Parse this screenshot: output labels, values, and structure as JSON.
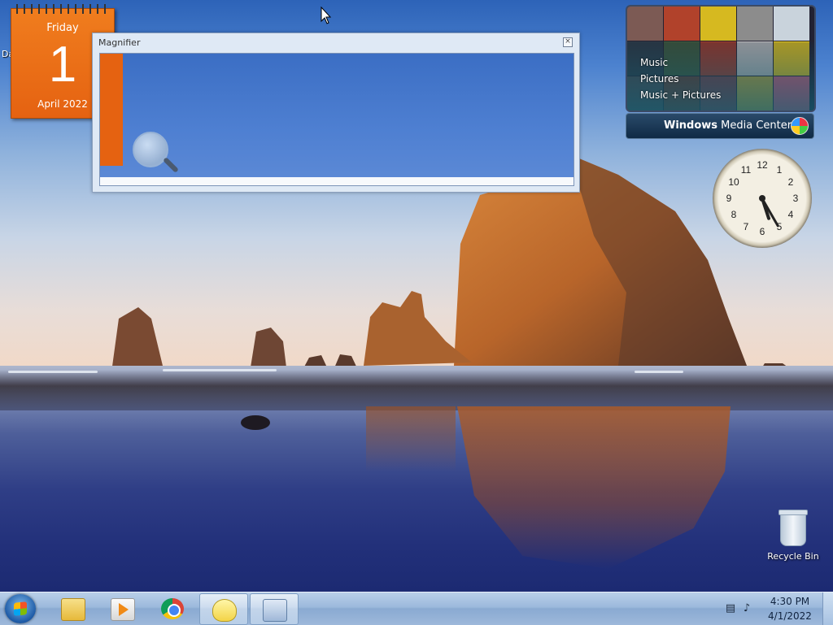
{
  "calendar": {
    "day_name": "Friday",
    "day_number": "1",
    "month_year": "April 2022",
    "partial_label": "Da"
  },
  "magnifier": {
    "title": "Magnifier",
    "close_glyph": "×"
  },
  "media_center": {
    "links": [
      "Music",
      "Pictures",
      "Music + Pictures"
    ],
    "brand_strong": "Windows",
    "brand_light": " Media Center"
  },
  "clock": {
    "numerals": [
      "12",
      "1",
      "2",
      "3",
      "4",
      "5",
      "6",
      "7",
      "8",
      "9",
      "10",
      "11"
    ],
    "time_shown": "5:25"
  },
  "desktop": {
    "recycle_bin_label": "Recycle Bin"
  },
  "taskbar": {
    "pinned": [
      "file-explorer",
      "windows-media-player",
      "google-chrome",
      "desktop-gadgets",
      "magnifier"
    ],
    "time": "4:30 PM",
    "date": "4/1/2022"
  },
  "colors": {
    "calendar_orange": "#e56211",
    "taskbar_blue": "#9cb9dc"
  }
}
